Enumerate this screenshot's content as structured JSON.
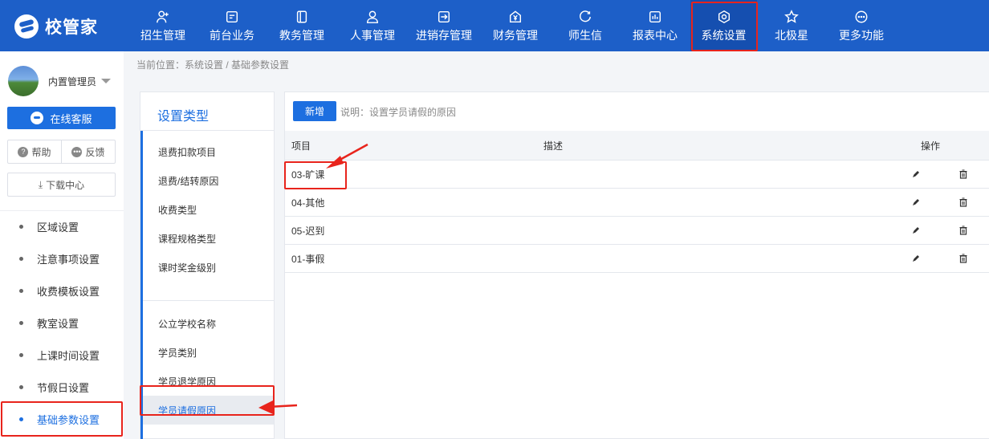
{
  "header": {
    "logo_text": "校管家",
    "nav": [
      {
        "label": "招生管理",
        "icon": "user-add-icon"
      },
      {
        "label": "前台业务",
        "icon": "screen-icon"
      },
      {
        "label": "教务管理",
        "icon": "book-icon"
      },
      {
        "label": "人事管理",
        "icon": "person-icon"
      },
      {
        "label": "进销存管理",
        "icon": "export-icon"
      },
      {
        "label": "财务管理",
        "icon": "yuan-icon"
      },
      {
        "label": "师生信",
        "icon": "chat-icon"
      },
      {
        "label": "报表中心",
        "icon": "report-icon"
      },
      {
        "label": "系统设置",
        "icon": "settings-icon",
        "active": true
      },
      {
        "label": "北极星",
        "icon": "star-icon"
      },
      {
        "label": "更多功能",
        "icon": "more-icon"
      }
    ]
  },
  "sidebar": {
    "user_name": "内置管理员",
    "service_label": "在线客服",
    "help_label": "帮助",
    "feedback_label": "反馈",
    "download_label": "下载中心",
    "menu": [
      {
        "label": "区域设置"
      },
      {
        "label": "注意事项设置"
      },
      {
        "label": "收费模板设置"
      },
      {
        "label": "教室设置"
      },
      {
        "label": "上课时间设置"
      },
      {
        "label": "节假日设置"
      },
      {
        "label": "基础参数设置",
        "active": true
      }
    ]
  },
  "breadcrumb": "当前位置：系统设置 / 基础参数设置",
  "types": {
    "title": "设置类型",
    "items_group1": [
      "退费扣款项目",
      "退费/结转原因",
      "收费类型",
      "课程规格类型",
      "课时奖金级别"
    ],
    "items_group2": [
      "公立学校名称",
      "学员类别",
      "学员退学原因",
      "学员请假原因"
    ],
    "active_index": 3
  },
  "content": {
    "new_button": "新增",
    "note": "说明：设置学员请假的原因",
    "columns": {
      "item": "项目",
      "desc": "描述",
      "ops": "操作"
    },
    "rows": [
      {
        "item": "03-旷课",
        "desc": ""
      },
      {
        "item": "04-其他",
        "desc": ""
      },
      {
        "item": "05-迟到",
        "desc": ""
      },
      {
        "item": "01-事假",
        "desc": ""
      }
    ]
  },
  "colors": {
    "header_bg": "#1d5fc8",
    "accent": "#1d6fe0",
    "highlight": "#e8241c"
  }
}
